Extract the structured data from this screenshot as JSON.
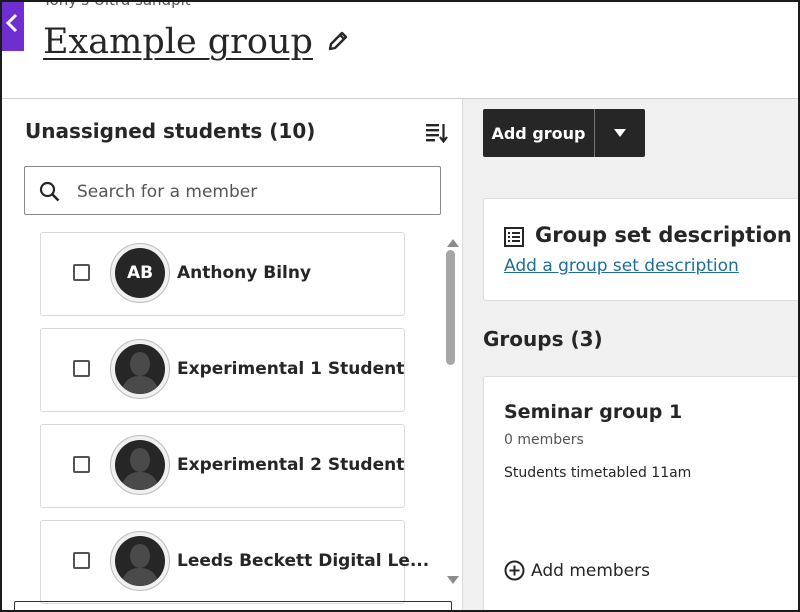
{
  "header": {
    "course_name": "Tony's Ultra sandpit",
    "page_title": "Example group",
    "close_icon": "chevron-left-icon",
    "edit_icon": "pencil-icon",
    "accent_color": "#6f2fd0"
  },
  "unassigned": {
    "heading": "Unassigned students (10)",
    "sort_icon": "sort-icon",
    "search": {
      "placeholder": "Search for a member",
      "value": ""
    },
    "students": [
      {
        "name": "Anthony Bilny",
        "initials": "AB",
        "avatar": "initials",
        "checked": false
      },
      {
        "name": "Experimental 1 Student",
        "initials": "",
        "avatar": "silhouette-icon",
        "checked": false
      },
      {
        "name": "Experimental 2 Student",
        "initials": "",
        "avatar": "silhouette-icon",
        "checked": false
      },
      {
        "name": "Leeds Beckett Digital Le...",
        "initials": "",
        "avatar": "silhouette-icon",
        "checked": false
      }
    ]
  },
  "toolbar": {
    "add_group_label": "Add group",
    "dropdown_icon": "caret-down-icon"
  },
  "description": {
    "title": "Group set description",
    "link": "Add a group set description",
    "icon": "list-document-icon"
  },
  "groups": {
    "heading": "Groups (3)",
    "items": [
      {
        "name": "Seminar group 1",
        "member_count": "0 members",
        "description": "Students timetabled 11am",
        "add_members_label": "Add members"
      }
    ]
  }
}
